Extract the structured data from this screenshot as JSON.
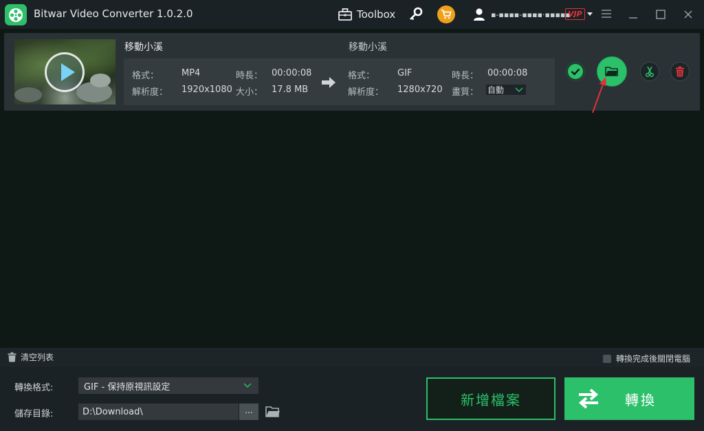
{
  "app": {
    "title": "Bitwar Video Converter  1.0.2.0",
    "toolbox_label": "Toolbox",
    "user_name": "▪-▪▪▪▪-▪▪▪▪·▪▪▪▪▪ .",
    "vip_label": "VIP"
  },
  "item": {
    "source_name": "移動小溪",
    "output_name": "移動小溪",
    "source": {
      "format_label": "格式：",
      "format_value": "MP4",
      "duration_label": "時長：",
      "duration_value": "00:00:08",
      "resolution_label": "解析度：",
      "resolution_value": "1920x1080",
      "size_label": "大小：",
      "size_value": "17.8 MB"
    },
    "output": {
      "format_label": "格式：",
      "format_value": "GIF",
      "duration_label": "時長：",
      "duration_value": "00:00:08",
      "resolution_label": "解析度：",
      "resolution_value": "1280x720",
      "quality_label": "畫質：",
      "quality_value": "自動"
    }
  },
  "footer": {
    "clear_list_label": "清空列表",
    "shutdown_label": "轉換完成後關閉電腦"
  },
  "settings": {
    "format_label": "轉換格式:",
    "format_value": "GIF - 保持原視訊設定",
    "save_dir_label": "儲存目錄:",
    "save_dir_value": "D:\\Download\\",
    "browse_label": "...",
    "add_file_label": "新增檔案",
    "convert_label": "轉換"
  },
  "colors": {
    "accent": "#2cc06a",
    "vip": "#e0323a",
    "cart": "#f0a11a",
    "annotation": "#e0323a"
  },
  "icons": [
    "app-logo-icon",
    "toolbox-icon",
    "key-icon",
    "cart-icon",
    "user-icon",
    "caret-down-icon",
    "menu-icon",
    "minimize-icon",
    "maximize-icon",
    "close-icon",
    "play-icon",
    "arrow-right-icon",
    "check-icon",
    "folder-icon",
    "scissors-icon",
    "trash-icon",
    "convert-icon"
  ]
}
